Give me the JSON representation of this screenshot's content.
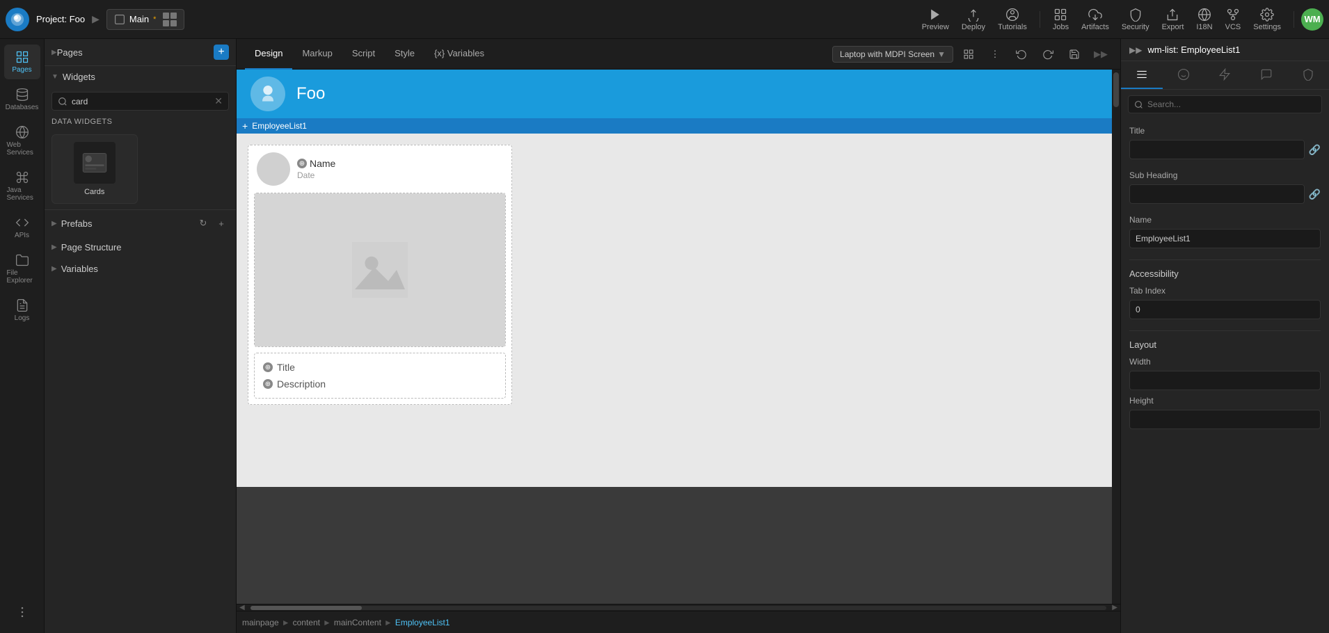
{
  "topbar": {
    "project_label": "Project:",
    "project_name": "Foo",
    "tab_name": "Main",
    "tab_modified": "*",
    "preview_label": "Preview",
    "deploy_label": "Deploy",
    "tutorials_label": "Tutorials",
    "jobs_label": "Jobs",
    "artifacts_label": "Artifacts",
    "security_label": "Security",
    "export_label": "Export",
    "i18n_label": "I18N",
    "vcs_label": "VCS",
    "settings_label": "Settings",
    "user_initials": "WM"
  },
  "toolbar": {
    "design_tab": "Design",
    "markup_tab": "Markup",
    "script_tab": "Script",
    "style_tab": "Style",
    "variables_tab": "{x} Variables",
    "screen_dropdown": "Laptop with MDPI Screen",
    "component_title": "wm-list: EmployeeList1"
  },
  "left_panel": {
    "pages_label": "Pages",
    "widgets_label": "Widgets",
    "search_placeholder": "card",
    "data_widgets_label": "Data widgets",
    "cards_label": "Cards",
    "prefabs_label": "Prefabs",
    "page_structure_label": "Page Structure",
    "variables_label": "Variables",
    "web_services_label": "Web Services",
    "java_services_label": "Java Services",
    "apis_label": "APIs",
    "file_explorer_label": "File Explorer",
    "logs_label": "Logs"
  },
  "canvas": {
    "app_name": "Foo",
    "selection_label": "EmployeeList1",
    "card_name": "Name",
    "card_date": "Date",
    "card_title": "Title",
    "card_description": "Description"
  },
  "breadcrumb": {
    "items": [
      "mainpage",
      "content",
      "mainContent",
      "EmployeeList1"
    ]
  },
  "right_panel": {
    "component_title": "wm-list: EmployeeList1",
    "search_placeholder": "Search...",
    "title_label": "Title",
    "subheading_label": "Sub Heading",
    "name_label": "Name",
    "name_value": "EmployeeList1",
    "accessibility_label": "Accessibility",
    "tab_index_label": "Tab Index",
    "tab_index_value": "0",
    "layout_label": "Layout",
    "width_label": "Width",
    "height_label": "Height"
  }
}
